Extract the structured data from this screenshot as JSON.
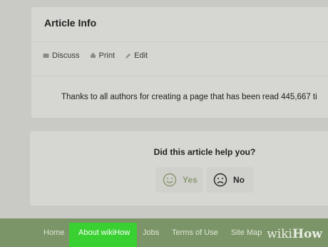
{
  "article_info": {
    "title": "Article Info",
    "actions": [
      {
        "label": "Discuss",
        "icon": "discuss-icon"
      },
      {
        "label": "Print",
        "icon": "print-icon"
      },
      {
        "label": "Edit",
        "icon": "edit-icon"
      }
    ],
    "thanks_text": "Thanks to all authors for creating a page that has been read 445,667 ti"
  },
  "feedback": {
    "question": "Did this article help you?",
    "yes_label": "Yes",
    "no_label": "No"
  },
  "footer": {
    "links": [
      "Home",
      "About wikiHow",
      "Jobs",
      "Terms of Use",
      "Site Map"
    ],
    "highlighted_link": "About wikiHow",
    "highlight_color": "#39d132",
    "logo_wiki": "wiki",
    "logo_how": "How"
  },
  "colors": {
    "background": "#c9c9c5",
    "card": "#d6d6d2",
    "footer": "#7b9468"
  }
}
